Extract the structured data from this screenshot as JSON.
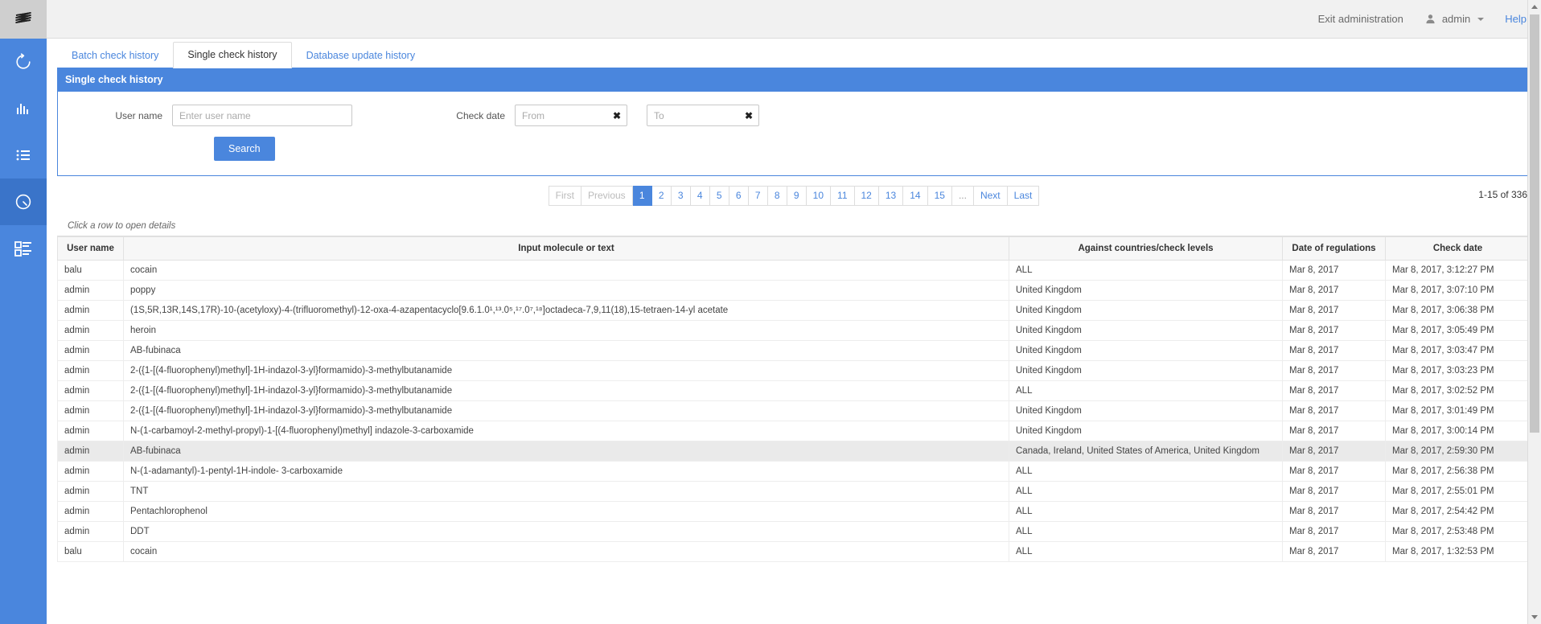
{
  "sidebar": {
    "logo_icon": "stacked-s-logo",
    "items": [
      {
        "icon": "refresh-circle-icon",
        "name": "nav-refresh",
        "active": false
      },
      {
        "icon": "bar-chart-icon",
        "name": "nav-statistics",
        "active": false
      },
      {
        "icon": "list-icon",
        "name": "nav-list",
        "active": false
      },
      {
        "icon": "clock-history-icon",
        "name": "nav-history",
        "active": true
      },
      {
        "icon": "dashboard-blocks-icon",
        "name": "nav-dashboard",
        "active": false
      }
    ]
  },
  "topbar": {
    "exit_admin": "Exit administration",
    "user_icon": "user-avatar-icon",
    "user_name": "admin",
    "help": "Help"
  },
  "tabs": [
    {
      "label": "Batch check history",
      "active": false
    },
    {
      "label": "Single check history",
      "active": true
    },
    {
      "label": "Database update history",
      "active": false
    }
  ],
  "panel": {
    "title": "Single check history",
    "form": {
      "user_label": "User name",
      "user_placeholder": "Enter user name",
      "user_value": "",
      "date_label": "Check date",
      "from_placeholder": "From",
      "from_value": "",
      "to_placeholder": "To",
      "to_value": "",
      "clear_icon": "clear-x-icon",
      "search_button": "Search"
    }
  },
  "pagination": {
    "first": "First",
    "previous": "Previous",
    "pages": [
      "1",
      "2",
      "3",
      "4",
      "5",
      "6",
      "7",
      "8",
      "9",
      "10",
      "11",
      "12",
      "13",
      "14",
      "15"
    ],
    "ellipsis": "...",
    "next": "Next",
    "last": "Last",
    "current": "1",
    "count_text": "1-15 of 336"
  },
  "table": {
    "hint": "Click a row to open details",
    "columns": [
      "User name",
      "Input molecule or text",
      "Against countries/check levels",
      "Date of regulations",
      "Check date"
    ],
    "rows": [
      {
        "user": "balu",
        "molecule": "cocain",
        "countries": "ALL",
        "regulations": "Mar 8, 2017",
        "check": "Mar 8, 2017, 3:12:27 PM",
        "highlight": false
      },
      {
        "user": "admin",
        "molecule": "poppy",
        "countries": "United Kingdom",
        "regulations": "Mar 8, 2017",
        "check": "Mar 8, 2017, 3:07:10 PM",
        "highlight": false
      },
      {
        "user": "admin",
        "molecule": "(1S,5R,13R,14S,17R)-10-(acetyloxy)-4-(trifluoromethyl)-12-oxa-4-azapentacyclo[9.6.1.0¹,¹³.0⁵,¹⁷.0⁷,¹⁸]octadeca-7,9,11(18),15-tetraen-14-yl acetate",
        "countries": "United Kingdom",
        "regulations": "Mar 8, 2017",
        "check": "Mar 8, 2017, 3:06:38 PM",
        "highlight": false
      },
      {
        "user": "admin",
        "molecule": "heroin",
        "countries": "United Kingdom",
        "regulations": "Mar 8, 2017",
        "check": "Mar 8, 2017, 3:05:49 PM",
        "highlight": false
      },
      {
        "user": "admin",
        "molecule": "AB-fubinaca",
        "countries": "United Kingdom",
        "regulations": "Mar 8, 2017",
        "check": "Mar 8, 2017, 3:03:47 PM",
        "highlight": false
      },
      {
        "user": "admin",
        "molecule": "2-({1-[(4-fluorophenyl)methyl]-1H-indazol-3-yl}formamido)-3-methylbutanamide",
        "countries": "United Kingdom",
        "regulations": "Mar 8, 2017",
        "check": "Mar 8, 2017, 3:03:23 PM",
        "highlight": false
      },
      {
        "user": "admin",
        "molecule": "2-({1-[(4-fluorophenyl)methyl]-1H-indazol-3-yl}formamido)-3-methylbutanamide",
        "countries": "ALL",
        "regulations": "Mar 8, 2017",
        "check": "Mar 8, 2017, 3:02:52 PM",
        "highlight": false
      },
      {
        "user": "admin",
        "molecule": "2-({1-[(4-fluorophenyl)methyl]-1H-indazol-3-yl}formamido)-3-methylbutanamide",
        "countries": "United Kingdom",
        "regulations": "Mar 8, 2017",
        "check": "Mar 8, 2017, 3:01:49 PM",
        "highlight": false
      },
      {
        "user": "admin",
        "molecule": "N-(1-carbamoyl-2-methyl-propyl)-1-[(4-fluorophenyl)methyl] indazole-3-carboxamide",
        "countries": "United Kingdom",
        "regulations": "Mar 8, 2017",
        "check": "Mar 8, 2017, 3:00:14 PM",
        "highlight": false
      },
      {
        "user": "admin",
        "molecule": "AB-fubinaca",
        "countries": "Canada, Ireland, United States of America, United Kingdom",
        "regulations": "Mar 8, 2017",
        "check": "Mar 8, 2017, 2:59:30 PM",
        "highlight": true
      },
      {
        "user": "admin",
        "molecule": "N-(1-adamantyl)-1-pentyl-1H-indole- 3-carboxamide",
        "countries": "ALL",
        "regulations": "Mar 8, 2017",
        "check": "Mar 8, 2017, 2:56:38 PM",
        "highlight": false
      },
      {
        "user": "admin",
        "molecule": "TNT",
        "countries": "ALL",
        "regulations": "Mar 8, 2017",
        "check": "Mar 8, 2017, 2:55:01 PM",
        "highlight": false
      },
      {
        "user": "admin",
        "molecule": "Pentachlorophenol",
        "countries": "ALL",
        "regulations": "Mar 8, 2017",
        "check": "Mar 8, 2017, 2:54:42 PM",
        "highlight": false
      },
      {
        "user": "admin",
        "molecule": "DDT",
        "countries": "ALL",
        "regulations": "Mar 8, 2017",
        "check": "Mar 8, 2017, 2:53:48 PM",
        "highlight": false
      },
      {
        "user": "balu",
        "molecule": "cocain",
        "countries": "ALL",
        "regulations": "Mar 8, 2017",
        "check": "Mar 8, 2017, 1:32:53 PM",
        "highlight": false
      }
    ]
  },
  "colors": {
    "accent": "#4a86dd",
    "sidebar": "#4a86dd",
    "sidebar_active": "#3a74c9",
    "topbar": "#f1f1f1",
    "row_highlight": "#eaeaea"
  }
}
